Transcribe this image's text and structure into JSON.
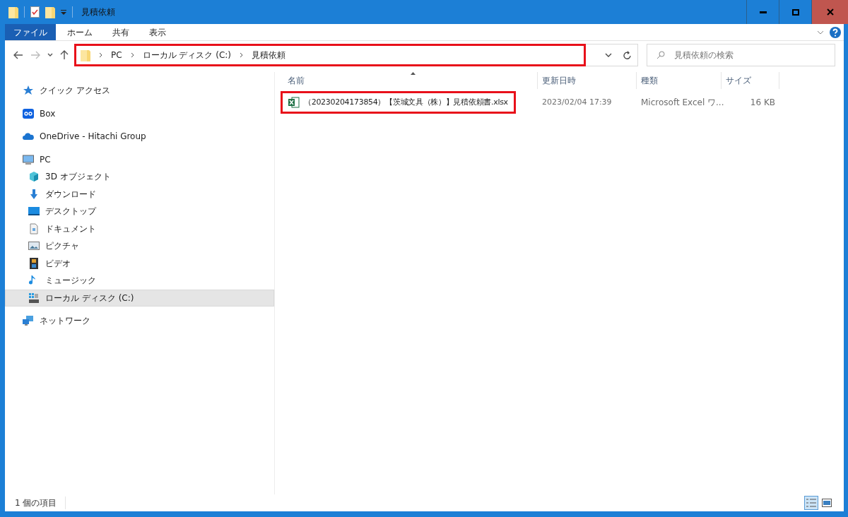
{
  "window": {
    "title": "見積依頼"
  },
  "tabs": [
    {
      "label": "ファイル",
      "selected": true
    },
    {
      "label": "ホーム",
      "selected": false
    },
    {
      "label": "共有",
      "selected": false
    },
    {
      "label": "表示",
      "selected": false
    }
  ],
  "address": {
    "highlighted": true,
    "crumbs": [
      "PC",
      "ローカル ディスク (C:)",
      "見積依頼"
    ]
  },
  "search": {
    "placeholder": "見積依頼の検索"
  },
  "sidebar": {
    "items": [
      {
        "label": "クイック アクセス",
        "kind": "star",
        "selected": false
      },
      {
        "label": "Box",
        "kind": "box",
        "selected": false
      },
      {
        "label": "OneDrive - Hitachi Group",
        "kind": "cloud",
        "selected": false
      },
      {
        "label": "PC",
        "kind": "pc",
        "selected": false,
        "children": [
          {
            "label": "3D オブジェクト",
            "kind": "cube",
            "selected": false
          },
          {
            "label": "ダウンロード",
            "kind": "download",
            "selected": false
          },
          {
            "label": "デスクトップ",
            "kind": "desktop",
            "selected": false
          },
          {
            "label": "ドキュメント",
            "kind": "document",
            "selected": false
          },
          {
            "label": "ピクチャ",
            "kind": "picture",
            "selected": false
          },
          {
            "label": "ビデオ",
            "kind": "video",
            "selected": false
          },
          {
            "label": "ミュージック",
            "kind": "music",
            "selected": false
          },
          {
            "label": "ローカル ディスク (C:)",
            "kind": "disk",
            "selected": true
          }
        ]
      },
      {
        "label": "ネットワーク",
        "kind": "network",
        "selected": false
      }
    ]
  },
  "table": {
    "columns": [
      {
        "label": "名前",
        "sorted": true
      },
      {
        "label": "更新日時",
        "sorted": false
      },
      {
        "label": "種類",
        "sorted": false
      },
      {
        "label": "サイズ",
        "sorted": false
      }
    ],
    "rows": [
      {
        "name": "（20230204173854）【茨城文具（株）】見積依頼書.xlsx",
        "modified": "2023/02/04 17:39",
        "type": "Microsoft Excel ワ...",
        "size": "16 KB",
        "highlighted": true
      }
    ]
  },
  "status_bar": {
    "text": "1 個の項目",
    "views": [
      {
        "kind": "details",
        "selected": true
      },
      {
        "kind": "tiles",
        "selected": false
      }
    ]
  }
}
